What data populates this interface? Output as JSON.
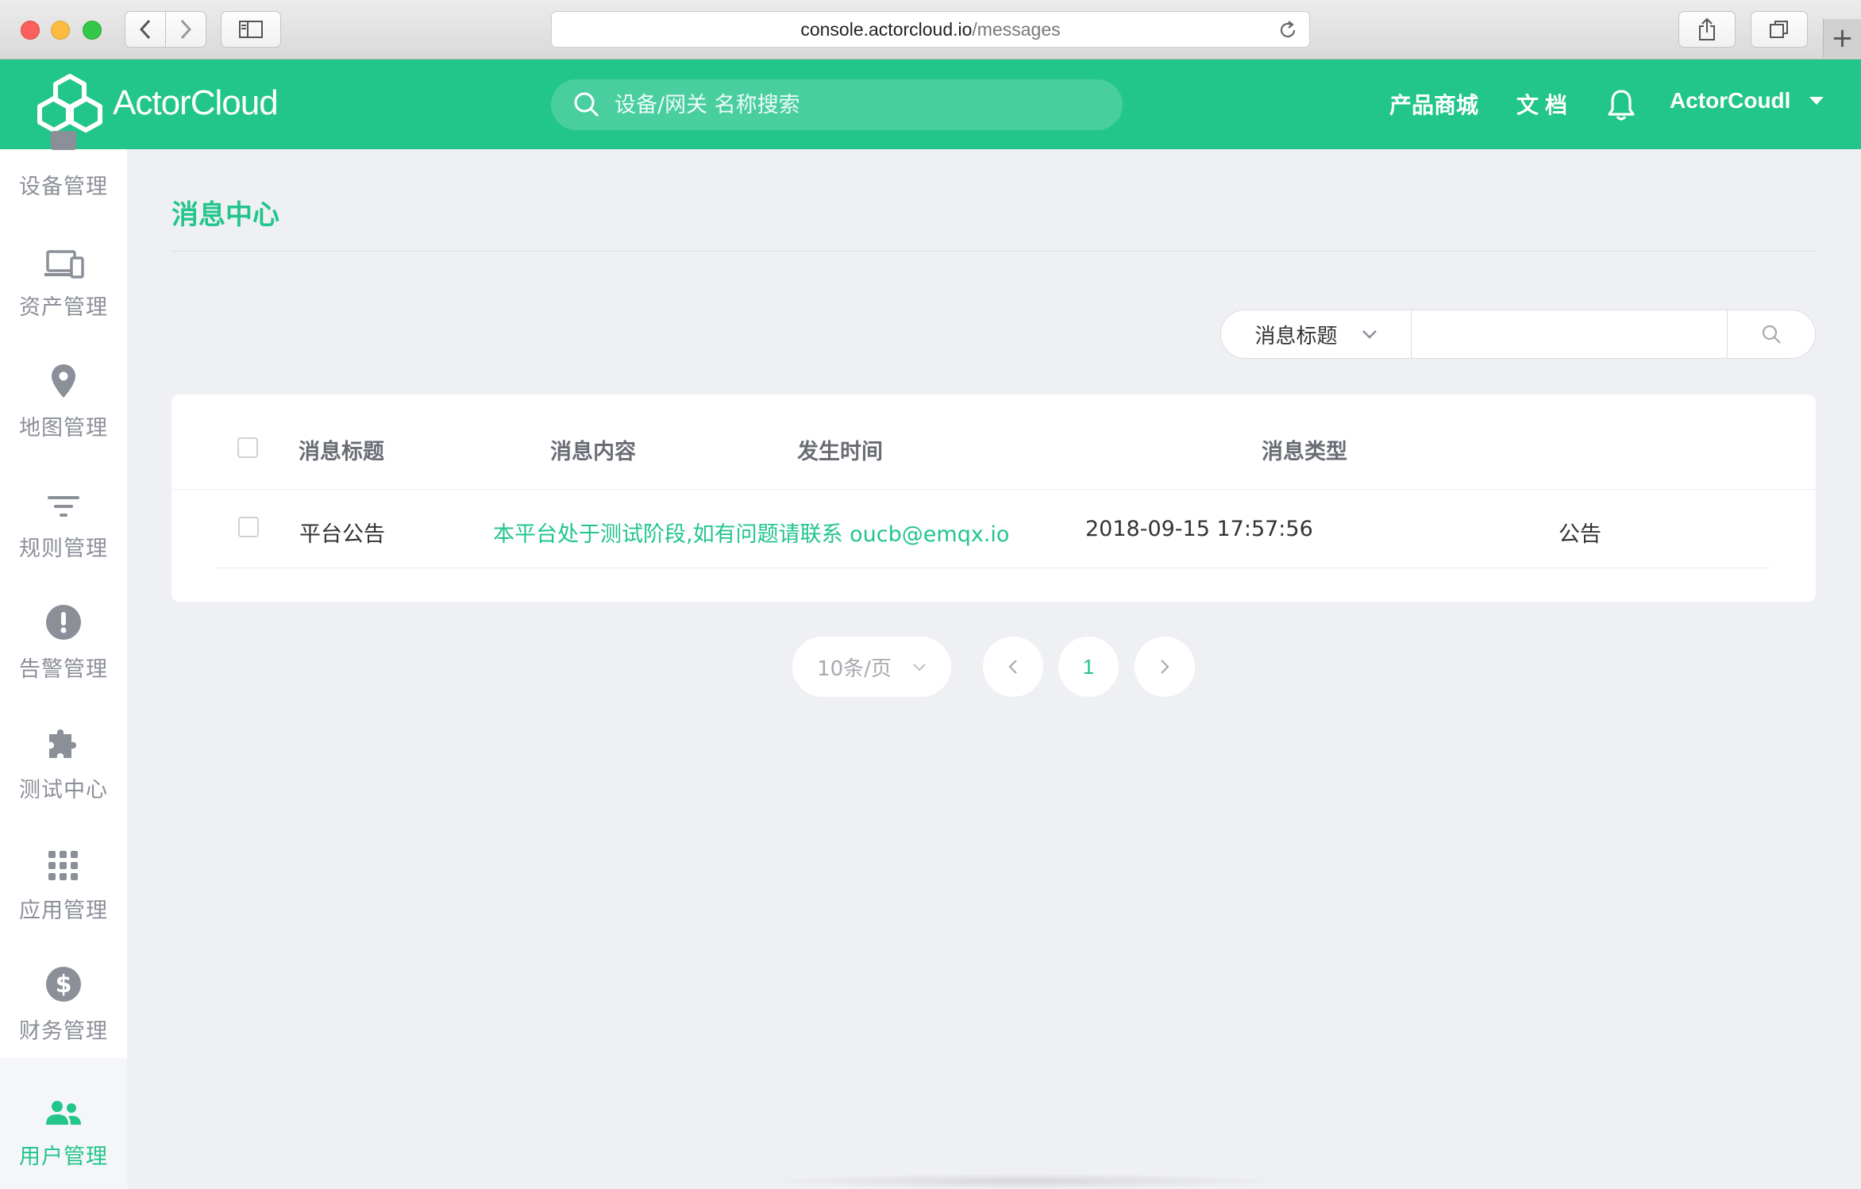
{
  "browser": {
    "url_domain": "console.actorcloud.io",
    "url_path": "/messages"
  },
  "header": {
    "logo_text": "ActorCloud",
    "search_placeholder": "设备/网关 名称搜索",
    "nav_store": "产品商城",
    "nav_docs": "文档",
    "user_name": "ActorCoudl",
    "accent_color": "#22c58a"
  },
  "sidebar": {
    "items": [
      {
        "label": "设备管理",
        "icon": "device-icon"
      },
      {
        "label": "资产管理",
        "icon": "devices-icon"
      },
      {
        "label": "地图管理",
        "icon": "map-pin-icon"
      },
      {
        "label": "规则管理",
        "icon": "filter-icon"
      },
      {
        "label": "告警管理",
        "icon": "alert-icon"
      },
      {
        "label": "测试中心",
        "icon": "puzzle-icon"
      },
      {
        "label": "应用管理",
        "icon": "grid-icon"
      },
      {
        "label": "财务管理",
        "icon": "dollar-icon"
      },
      {
        "label": "用户管理",
        "icon": "users-icon",
        "active": true
      }
    ]
  },
  "main": {
    "title": "消息中心",
    "filter": {
      "select_value": "消息标题",
      "input_value": ""
    },
    "table": {
      "columns": [
        "消息标题",
        "消息内容",
        "发生时间",
        "消息类型"
      ],
      "rows": [
        {
          "title": "平台公告",
          "content": "本平台处于测试阶段,如有问题请联系 oucb@emqx.io",
          "time": "2018-09-15 17:57:56",
          "type": "公告"
        }
      ]
    },
    "pagination": {
      "page_size": "10条/页",
      "current_page": "1"
    }
  }
}
